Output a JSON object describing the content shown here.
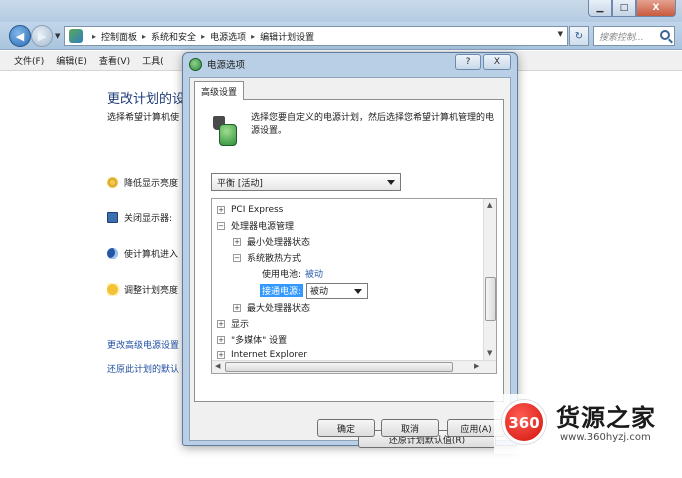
{
  "window": {
    "minimize": "▁",
    "maximize": "□",
    "close": "X"
  },
  "address": {
    "breadcrumbs": [
      "控制面板",
      "系统和安全",
      "电源选项",
      "编辑计划设置"
    ],
    "search_placeholder": "搜索控制..."
  },
  "menubar": {
    "items": [
      "文件(F)",
      "编辑(E)",
      "查看(V)",
      "工具("
    ]
  },
  "control_panel": {
    "title": "更改计划的设",
    "subtitle": "选择希望计算机使",
    "rows": [
      {
        "label": "降低显示亮度",
        "icon": "brightness-icon"
      },
      {
        "label": "关闭显示器:",
        "icon": "monitor-icon"
      },
      {
        "label": "使计算机进入",
        "icon": "sleep-icon"
      },
      {
        "label": "调整计划亮度",
        "icon": "sun-icon"
      }
    ],
    "links": [
      "更改高级电源设置",
      "还原此计划的默认"
    ]
  },
  "dialog": {
    "title": "电源选项",
    "help": "?",
    "close": "X",
    "tab": "高级设置",
    "description": "选择您要自定义的电源计划，然后选择您希望计算机管理的电源设置。",
    "scheme": "平衡 [活动]",
    "tree": [
      {
        "exp": "+",
        "label": "PCI Express",
        "indent": 0
      },
      {
        "exp": "−",
        "label": "处理器电源管理",
        "indent": 0
      },
      {
        "exp": "+",
        "label": "最小处理器状态",
        "indent": 1
      },
      {
        "exp": "−",
        "label": "系统散热方式",
        "indent": 1
      },
      {
        "label": "使用电池:",
        "value": "被动",
        "indent": 2
      },
      {
        "label": "接通电源:",
        "select": "被动",
        "indent": 2
      },
      {
        "exp": "+",
        "label": "最大处理器状态",
        "indent": 1
      },
      {
        "exp": "+",
        "label": "显示",
        "indent": 0
      },
      {
        "exp": "+",
        "label": "\"多媒体\" 设置",
        "indent": 0
      },
      {
        "exp": "+",
        "label": "Internet Explorer",
        "indent": 0
      }
    ],
    "restore_button": "还原计划默认值(R)",
    "ok_button": "确定",
    "cancel_button": "取消",
    "apply_button": "应用(A)"
  },
  "watermark": {
    "logo_text": "360",
    "name": "货源之家",
    "url": "www.360hyzj.com"
  }
}
